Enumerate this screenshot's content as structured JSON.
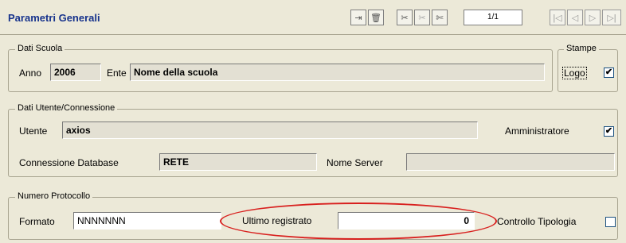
{
  "header": {
    "title": "Parametri Generali",
    "record_indicator": "1/1",
    "toolbar_icons": [
      "insert-icon",
      "delete-icon",
      "scissors-icon",
      "scissors-disabled-icon",
      "tool-icon"
    ],
    "nav_icons": [
      "first-record-icon",
      "prev-record-icon",
      "next-record-icon",
      "last-record-icon"
    ]
  },
  "dati_scuola": {
    "legend": "Dati Scuola",
    "anno_label": "Anno",
    "anno_value": "2006",
    "ente_label": "Ente",
    "ente_value": "Nome della scuola"
  },
  "stampe": {
    "legend": "Stampe",
    "logo_label": "Logo",
    "logo_checked": "✔"
  },
  "dati_utente": {
    "legend": "Dati Utente/Connessione",
    "utente_label": "Utente",
    "utente_value": "axios",
    "amministratore_label": "Amministratore",
    "amministratore_checked": "✔",
    "connessione_label": "Connessione Database",
    "connessione_value": "RETE",
    "nome_server_label": "Nome Server",
    "nome_server_value": ""
  },
  "protocollo": {
    "legend": "Numero Protocollo",
    "formato_label": "Formato",
    "formato_value": "NNNNNNN",
    "ultimo_label": "Ultimo registrato",
    "ultimo_value": "0",
    "controllo_label": "Controllo Tipologia",
    "controllo_checked": ""
  },
  "colors": {
    "title": "#17338c",
    "background": "#ece9d8",
    "annotation": "#d8201e"
  }
}
